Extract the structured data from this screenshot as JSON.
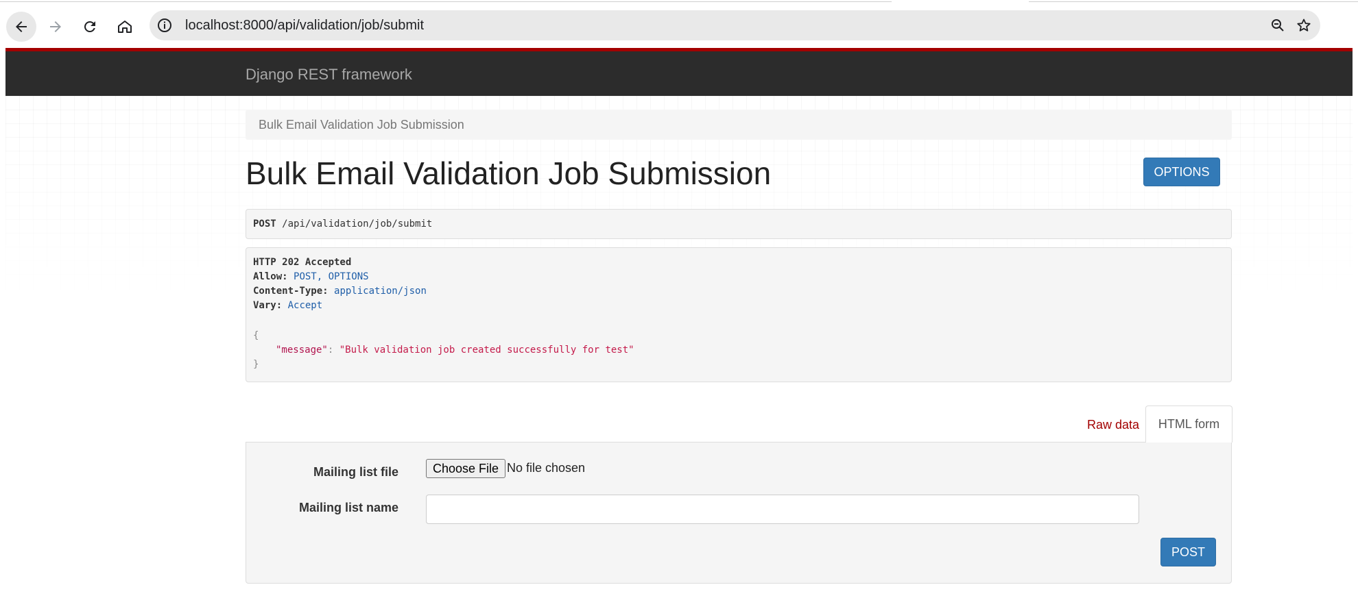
{
  "browser": {
    "url": "localhost:8000/api/validation/job/submit"
  },
  "navbar": {
    "brand": "Django REST framework"
  },
  "breadcrumb": {
    "current": "Bulk Email Validation Job Submission"
  },
  "page": {
    "title": "Bulk Email Validation Job Submission",
    "options_label": "OPTIONS"
  },
  "request": {
    "method": "POST",
    "path": "/api/validation/job/submit"
  },
  "response": {
    "status": "HTTP 202 Accepted",
    "headers": [
      {
        "name": "Allow:",
        "value": "POST, OPTIONS"
      },
      {
        "name": "Content-Type:",
        "value": "application/json"
      },
      {
        "name": "Vary:",
        "value": "Accept"
      }
    ],
    "body_open": "{",
    "body_key": "\"message\"",
    "body_colon": ": ",
    "body_value": "\"Bulk validation job created successfully for test\"",
    "body_close": "}"
  },
  "tabs": {
    "raw": "Raw data",
    "html": "HTML form"
  },
  "form": {
    "file_label": "Mailing list file",
    "file_button": "Choose File",
    "file_status": "No file chosen",
    "name_label": "Mailing list name",
    "name_value": "",
    "submit_label": "POST"
  },
  "colors": {
    "primary": "#337ab7",
    "navbar": "#2c2c2c",
    "accent": "#a30000"
  }
}
